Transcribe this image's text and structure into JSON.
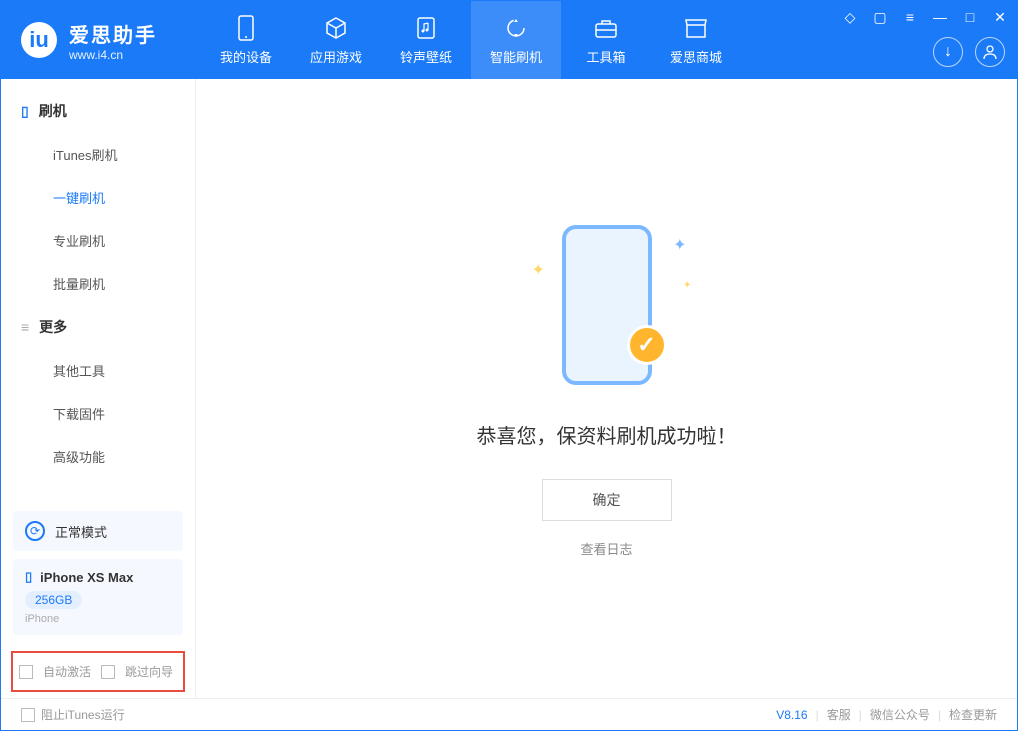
{
  "app": {
    "title": "爱思助手",
    "subtitle": "www.i4.cn"
  },
  "nav": [
    {
      "label": "我的设备",
      "icon": "phone"
    },
    {
      "label": "应用游戏",
      "icon": "cube"
    },
    {
      "label": "铃声壁纸",
      "icon": "music"
    },
    {
      "label": "智能刷机",
      "icon": "refresh",
      "active": true
    },
    {
      "label": "工具箱",
      "icon": "toolbox"
    },
    {
      "label": "爱思商城",
      "icon": "store"
    }
  ],
  "sidebar": {
    "sections": [
      {
        "title": "刷机",
        "icon": "phone-icon",
        "items": [
          "iTunes刷机",
          "一键刷机",
          "专业刷机",
          "批量刷机"
        ],
        "activeIndex": 1
      },
      {
        "title": "更多",
        "icon": "menu-icon",
        "items": [
          "其他工具",
          "下载固件",
          "高级功能"
        ]
      }
    ],
    "mode": "正常模式",
    "device": {
      "name": "iPhone XS Max",
      "capacity": "256GB",
      "type": "iPhone"
    },
    "checkboxes": [
      "自动激活",
      "跳过向导"
    ]
  },
  "main": {
    "success_text": "恭喜您，保资料刷机成功啦！",
    "confirm_btn": "确定",
    "log_link": "查看日志"
  },
  "footer": {
    "block_itunes": "阻止iTunes运行",
    "version": "V8.16",
    "links": [
      "客服",
      "微信公众号",
      "检查更新"
    ]
  }
}
